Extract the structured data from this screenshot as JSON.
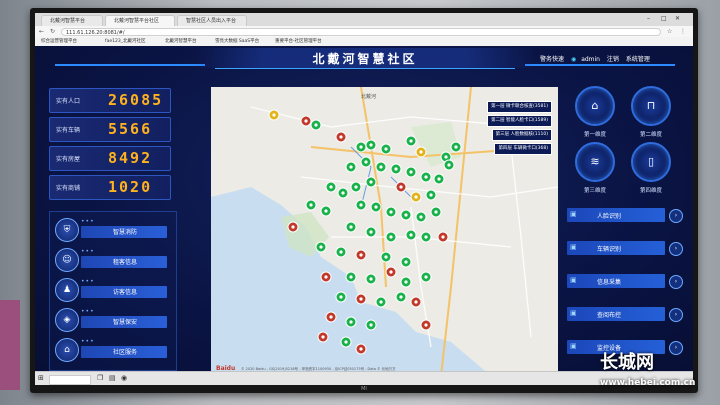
{
  "browser": {
    "tabs": [
      "北戴河智慧平台",
      "北戴河智慧平台社区",
      "智慧社区人员出入平台"
    ],
    "url": "111.61.126.20:8081/#/",
    "bookmarks": [
      "综合运营管理平台",
      "fae123_北戴河社区",
      "北戴河智慧平台",
      "雪亮大数据 SaaS平台",
      "重要平台-社区管理平台"
    ]
  },
  "dashboard": {
    "title": "北戴河智慧社区",
    "userbar": [
      "警务快速",
      "admin",
      "注销",
      "系统管理"
    ]
  },
  "stats": [
    {
      "label": "实有人口",
      "value": "26085"
    },
    {
      "label": "实有车辆",
      "value": "5566"
    },
    {
      "label": "实有房屋",
      "value": "8492"
    },
    {
      "label": "实有商铺",
      "value": "1020"
    }
  ],
  "menu": [
    {
      "label": "智慧消防",
      "icon": "shield-icon"
    },
    {
      "label": "租客信息",
      "icon": "person-icon"
    },
    {
      "label": "访客信息",
      "icon": "group-icon"
    },
    {
      "label": "智慧保安",
      "icon": "guard-icon"
    },
    {
      "label": "社区服务",
      "icon": "building-icon"
    }
  ],
  "map": {
    "legend": [
      "第一层 微卡联合核查(3581)",
      "第二层 智能人脸卡口(1589)",
      "第三层 人脸数据核(1110)",
      "第四层 车辆微卡口(368)"
    ],
    "logo": "Baidu",
    "copyright": "© 2020 Baidu - GS(2019)5218号 - 甲测资字1100930 - 京ICP证030173号 - Data © 长地万方",
    "city_label": "北戴河"
  },
  "dials": [
    {
      "label": "第一维度",
      "icon": "camera-icon"
    },
    {
      "label": "第二维度",
      "icon": "gate-icon"
    },
    {
      "label": "第三维度",
      "icon": "wifi-icon"
    },
    {
      "label": "第四维度",
      "icon": "door-icon"
    }
  ],
  "right_buttons": [
    {
      "label": "人脸识别",
      "icon": "face-icon"
    },
    {
      "label": "车辆识别",
      "icon": "car-icon"
    },
    {
      "label": "信息采集",
      "icon": "info-icon"
    },
    {
      "label": "查阅布控",
      "icon": "monitor-icon"
    },
    {
      "label": "监控设备",
      "icon": "camera-icon"
    }
  ],
  "monitor_brand": "MI",
  "watermark": {
    "main": "长城网",
    "sub": "www.hebei.com.cn"
  },
  "colors": {
    "accent": "#2f6ddf",
    "digits": "#ffb21e",
    "marker_green": "#18b14a",
    "marker_red": "#c0392b",
    "marker_yellow": "#e2b31a"
  }
}
